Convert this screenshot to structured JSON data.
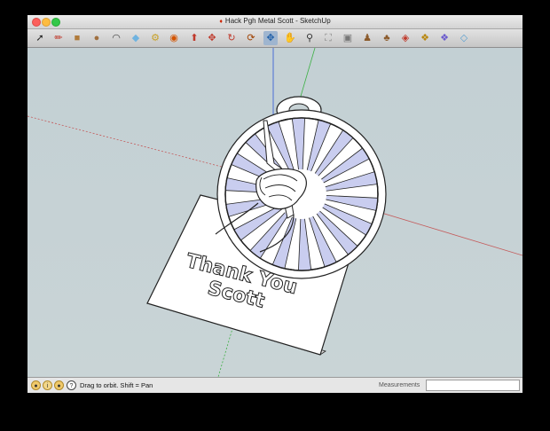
{
  "window": {
    "title": "Hack Pgh Metal Scott - SketchUp",
    "title_icon": "sketchup-icon"
  },
  "toolbar": {
    "tools": [
      {
        "name": "select-tool-icon",
        "glyph": "➚",
        "color": "#222222"
      },
      {
        "name": "pencil-tool-icon",
        "glyph": "✏",
        "color": "#c0392b"
      },
      {
        "name": "rectangle-tool-icon",
        "glyph": "■",
        "color": "#b07a3a"
      },
      {
        "name": "circle-tool-icon",
        "glyph": "●",
        "color": "#a07040"
      },
      {
        "name": "arc-tool-icon",
        "glyph": "◠",
        "color": "#444444"
      },
      {
        "name": "eraser-tool-icon",
        "glyph": "◆",
        "color": "#6fb3e0"
      },
      {
        "name": "tape-measure-tool-icon",
        "glyph": "⚙",
        "color": "#c9a227"
      },
      {
        "name": "paint-bucket-tool-icon",
        "glyph": "◉",
        "color": "#d35400"
      },
      {
        "name": "push-pull-tool-icon",
        "glyph": "⬆",
        "color": "#c0392b"
      },
      {
        "name": "move-tool-icon",
        "glyph": "✥",
        "color": "#c0392b"
      },
      {
        "name": "rotate-tool-icon",
        "glyph": "↻",
        "color": "#c0392b"
      },
      {
        "name": "offset-tool-icon",
        "glyph": "⟳",
        "color": "#a04000"
      },
      {
        "name": "orbit-tool-icon",
        "glyph": "✥",
        "color": "#1f5fa8"
      },
      {
        "name": "pan-tool-icon",
        "glyph": "✋",
        "color": "#555555"
      },
      {
        "name": "zoom-tool-icon",
        "glyph": "⚲",
        "color": "#333333"
      },
      {
        "name": "zoom-extents-tool-icon",
        "glyph": "⛶",
        "color": "#888888"
      },
      {
        "name": "previous-view-tool-icon",
        "glyph": "▣",
        "color": "#777777"
      },
      {
        "name": "position-camera-tool-icon",
        "glyph": "♟",
        "color": "#8b5a2b"
      },
      {
        "name": "walk-tool-icon",
        "glyph": "♣",
        "color": "#8b5a2b"
      },
      {
        "name": "warehouse-tool-icon",
        "glyph": "◈",
        "color": "#c0392b"
      },
      {
        "name": "share-model-tool-icon",
        "glyph": "❖",
        "color": "#b8860b"
      },
      {
        "name": "components-tool-icon",
        "glyph": "❖",
        "color": "#6a5acd"
      },
      {
        "name": "extension-tool-icon",
        "glyph": "◇",
        "color": "#5aa0d0"
      }
    ]
  },
  "model": {
    "line1": "Thank You",
    "line2": "Scott",
    "plate_color": "#ffffff",
    "ray_color": "#c9cdef",
    "outline_color": "#222222",
    "axis_red": "#c45b5b",
    "axis_green": "#3cb043",
    "axis_blue": "#2d55d6"
  },
  "status": {
    "hint": "Drag to orbit.  Shift = Pan",
    "measurements_label": "Measurements",
    "measurements_value": ""
  }
}
